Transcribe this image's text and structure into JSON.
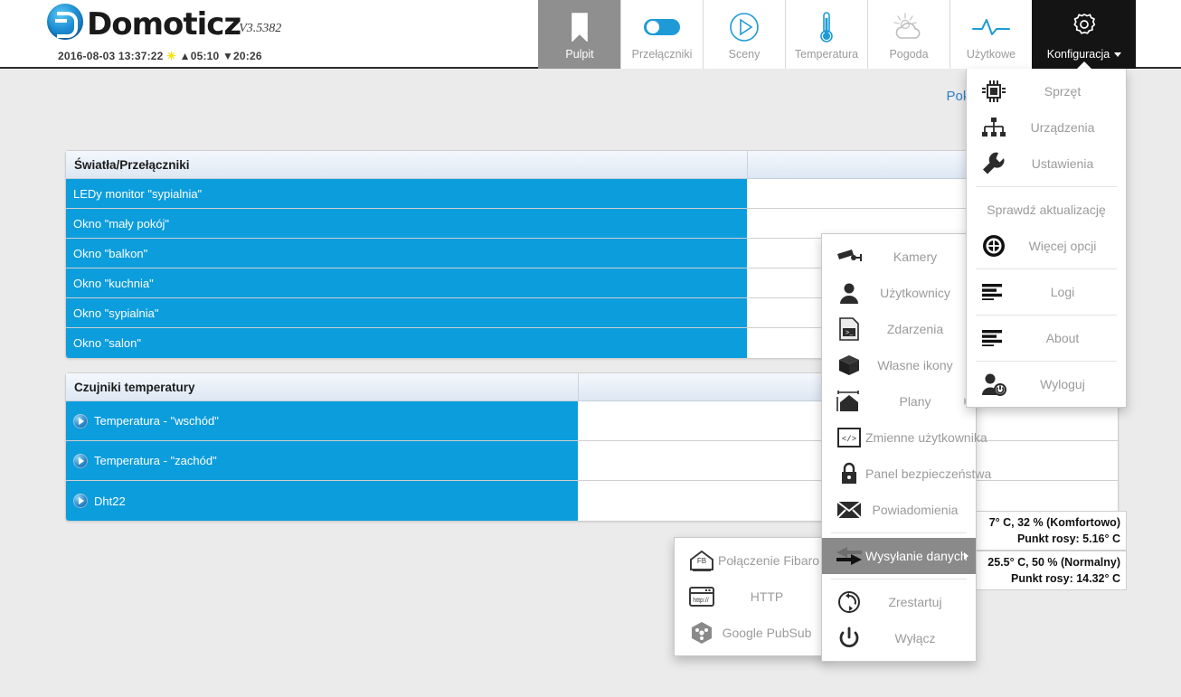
{
  "brand": {
    "name": "Domoticz",
    "version": "V3.5382",
    "logo_icon": "domoticz-logo-icon"
  },
  "clock": {
    "datetime": "2016-08-03 13:37:22",
    "sun_icon": "sun-icon",
    "sunrise_marker": "▲",
    "sunrise": "05:10",
    "sunset_marker": "▼",
    "sunset": "20:26"
  },
  "nav": {
    "items": [
      {
        "label": "Pulpit",
        "icon": "bookmark-icon",
        "state": "active-grey"
      },
      {
        "label": "Przełączniki",
        "icon": "toggle-icon",
        "state": "normal"
      },
      {
        "label": "Sceny",
        "icon": "play-circle-icon",
        "state": "normal"
      },
      {
        "label": "Temperatura",
        "icon": "thermometer-icon",
        "state": "normal"
      },
      {
        "label": "Pogoda",
        "icon": "weather-icon",
        "state": "normal"
      },
      {
        "label": "Użytkowe",
        "icon": "pulse-icon",
        "state": "normal"
      },
      {
        "label": "Konfiguracja",
        "icon": "gear-icon",
        "state": "active-dark"
      }
    ]
  },
  "content": {
    "room_link": "Pokój"
  },
  "panel_switches": {
    "title": "Światła/Przełączniki",
    "rows": [
      {
        "name": "LEDy monitor \"sypialnia\""
      },
      {
        "name": "Okno \"mały pokój\""
      },
      {
        "name": "Okno \"balkon\""
      },
      {
        "name": "Okno \"kuchnia\""
      },
      {
        "name": "Okno \"sypialnia\""
      },
      {
        "name": "Okno \"salon\""
      }
    ]
  },
  "panel_temps": {
    "title": "Czujniki temperatury",
    "rows": [
      {
        "name": "Temperatura - \"wschód\"",
        "icon": "play-icon"
      },
      {
        "name": "Temperatura - \"zachód\"",
        "icon": "play-icon"
      },
      {
        "name": "Dht22",
        "icon": "play-icon"
      }
    ]
  },
  "readouts": [
    {
      "line1": "7° C, 32 % (Komfortowo)",
      "line2": "Punkt rosy: 5.16° C"
    },
    {
      "line1": "25.5° C, 50 % (Normalny)",
      "line2": "Punkt rosy: 14.32° C"
    }
  ],
  "menu_config": {
    "items": [
      {
        "label": "Sprzęt",
        "icon": "chip-icon"
      },
      {
        "label": "Urządzenia",
        "icon": "sitemap-icon"
      },
      {
        "label": "Ustawienia",
        "icon": "wrench-icon"
      },
      {
        "label": "Sprawdź aktualizację",
        "icon": "none"
      },
      {
        "label": "Więcej opcji",
        "icon": "target-icon"
      },
      {
        "label": "Logi",
        "icon": "lines-icon"
      },
      {
        "label": "About",
        "icon": "lines-icon"
      },
      {
        "label": "Wyloguj",
        "icon": "logout-user-icon"
      }
    ]
  },
  "menu_more": {
    "items": [
      {
        "label": "Kamery",
        "icon": "camera-icon",
        "submenu": false,
        "highlight": false
      },
      {
        "label": "Użytkownicy",
        "icon": "user-icon",
        "submenu": false,
        "highlight": false
      },
      {
        "label": "Zdarzenia",
        "icon": "script-icon",
        "submenu": false,
        "highlight": false
      },
      {
        "label": "Własne ikony",
        "icon": "cube-icon",
        "submenu": false,
        "highlight": false
      },
      {
        "label": "Plany",
        "icon": "floorplan-icon",
        "submenu": true,
        "highlight": false
      },
      {
        "label": "Zmienne użytkownika",
        "icon": "code-icon",
        "submenu": false,
        "highlight": false
      },
      {
        "label": "Panel bezpieczeństwa",
        "icon": "lock-icon",
        "submenu": false,
        "highlight": false
      },
      {
        "label": "Powiadomienia",
        "icon": "envelope-icon",
        "submenu": false,
        "highlight": false
      },
      {
        "label": "Wysyłanie danych",
        "icon": "arrows-icon",
        "submenu": true,
        "highlight": true
      },
      {
        "label": "Zrestartuj",
        "icon": "restart-icon",
        "submenu": false,
        "highlight": false
      },
      {
        "label": "Wyłącz",
        "icon": "power-icon",
        "submenu": false,
        "highlight": false
      }
    ]
  },
  "menu_send": {
    "items": [
      {
        "label": "Połączenie Fibaro",
        "icon": "fibaro-icon"
      },
      {
        "label": "HTTP",
        "icon": "http-icon"
      },
      {
        "label": "Google PubSub",
        "icon": "pubsub-icon"
      }
    ]
  },
  "colors": {
    "accent_blue": "#0c9ddc",
    "link_blue": "#2f7fc4",
    "nav_active_grey": "#8f8f8f",
    "nav_active_dark": "#141414",
    "page_bg": "#ebebeb",
    "menu_highlight": "#8a8a8a"
  }
}
